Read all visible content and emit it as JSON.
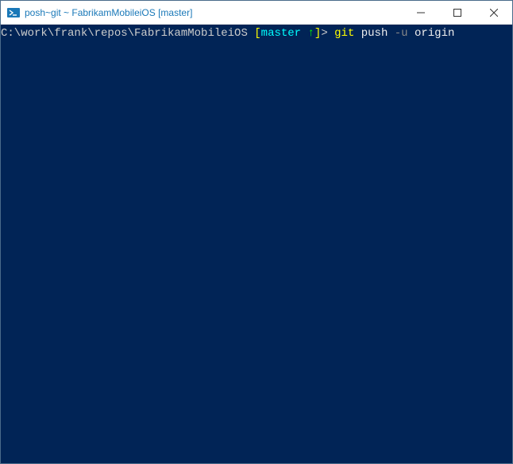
{
  "window": {
    "title": "posh~git ~ FabrikamMobileiOS [master]"
  },
  "prompt": {
    "path": "C:\\work\\frank\\repos\\FabrikamMobileiOS",
    "branch_open": " [",
    "branch_name": "master",
    "branch_arrow": " ↑",
    "branch_close": "]",
    "gt": "> ",
    "cmd_git": "git",
    "cmd_push": " push ",
    "cmd_flag": "-u",
    "cmd_origin": " origin"
  }
}
